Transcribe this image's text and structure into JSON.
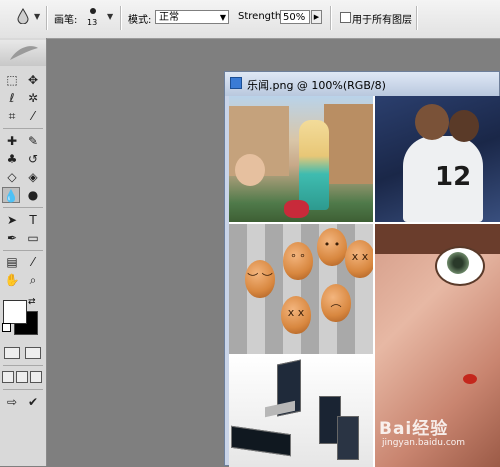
{
  "options_bar": {
    "brush_label": "画笔:",
    "brush_size": "13",
    "mode_label": "模式:",
    "mode_value": "正常",
    "strength_label": "Strength:",
    "strength_value": "50%",
    "all_layers_label": "用于所有图层",
    "all_layers_checked": false
  },
  "toolbox": {
    "foreground_color": "#ffffff",
    "background_color": "#000000",
    "active_tool": "smudge-tool"
  },
  "document": {
    "title": "乐闻.png @ 100%(RGB/8)"
  },
  "watermark": {
    "brand": "Bai经验",
    "url": "jingyan.baidu.com"
  },
  "colors": {
    "workspace": "#7f7f7f",
    "toolbar": "#e6e6e6",
    "doc_title": "#c9d4e8"
  }
}
